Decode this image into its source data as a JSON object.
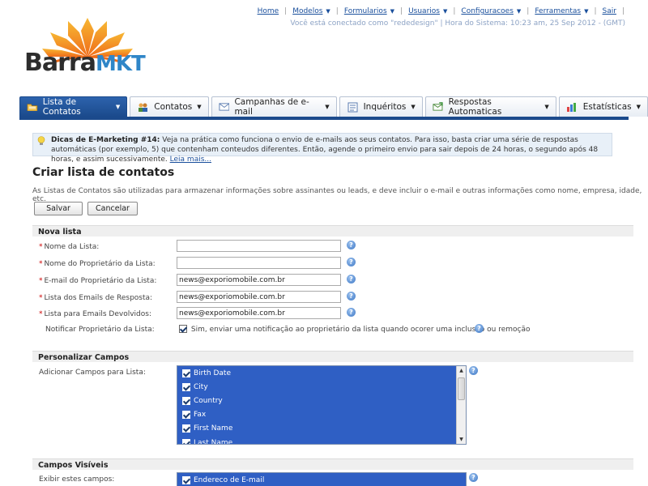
{
  "topnav": {
    "items": [
      {
        "label": "Home",
        "caret": false
      },
      {
        "label": "Modelos",
        "caret": true
      },
      {
        "label": "Formularios",
        "caret": true
      },
      {
        "label": "Usuarios",
        "caret": true
      },
      {
        "label": "Configuracoes",
        "caret": true
      },
      {
        "label": "Ferramentas",
        "caret": true
      },
      {
        "label": "Sair",
        "caret": false
      }
    ],
    "status": "Você está conectado como \"rededesign\" | Hora do Sistema: 10:23 am, 25 Sep 2012 - (GMT)"
  },
  "logo": {
    "part1": "Barra",
    "part2": "MKT"
  },
  "tabs": [
    {
      "label": "Lista de Contatos",
      "icon": "folder-icon",
      "active": true
    },
    {
      "label": "Contatos",
      "icon": "contacts-icon",
      "active": false
    },
    {
      "label": "Campanhas de e-mail",
      "icon": "envelope-icon",
      "active": false
    },
    {
      "label": "Inquéritos",
      "icon": "survey-icon",
      "active": false
    },
    {
      "label": "Respostas Automaticas",
      "icon": "autoresponder-icon",
      "active": false
    },
    {
      "label": "Estatísticas",
      "icon": "bar-chart-icon",
      "active": false
    }
  ],
  "tip": {
    "title": "Dicas de E-Marketing #14:",
    "text": " Veja na prática como funciona o envio de e-mails aos seus contatos. Para isso, basta criar uma série de respostas automáticas (por exemplo, 5) que contenham conteudos diferentes. Então, agende o primeiro envio para sair depois de 24 horas, o segundo após 48 horas, e assim sucessivamente. ",
    "link": "Leia mais..."
  },
  "page": {
    "title": "Criar lista de contatos",
    "description": "As Listas de Contatos são utilizadas para armazenar informações sobre assinantes ou leads, e deve incluir o e-mail e outras informações como nome, empresa, idade, etc."
  },
  "buttons": {
    "save": "Salvar",
    "cancel": "Cancelar"
  },
  "nova_lista": {
    "heading": "Nova lista",
    "fields": [
      {
        "label": "Nome da Lista:",
        "value": "",
        "required": true
      },
      {
        "label": "Nome do Proprietário da Lista:",
        "value": "",
        "required": true
      },
      {
        "label": "E-mail do Proprietário da Lista:",
        "value": "news@exporiomobile.com.br",
        "required": true
      },
      {
        "label": "Lista dos Emails de Resposta:",
        "value": "news@exporiomobile.com.br",
        "required": true
      },
      {
        "label": "Lista para Emails Devolvidos:",
        "value": "news@exporiomobile.com.br",
        "required": true
      }
    ],
    "notify": {
      "label": "Notificar Proprietário da Lista:",
      "checkbox_text": "Sim, enviar uma notificação ao proprietário da lista quando ocorer uma inclusão ou remoção",
      "checked": true
    }
  },
  "personalizar": {
    "heading": "Personalizar Campos",
    "label": "Adicionar Campos para Lista:",
    "options": [
      "Birth Date",
      "City",
      "Country",
      "Fax",
      "First Name",
      "Last Name"
    ]
  },
  "visiveis": {
    "heading": "Campos Visíveis",
    "label": "Exibir estes campos:",
    "options": [
      "Endereco de E-mail"
    ]
  },
  "colors": {
    "primary": "#1b4a8c",
    "link": "#1a4f9c",
    "listbox": "#2f5fc4",
    "required": "#cc0000"
  }
}
